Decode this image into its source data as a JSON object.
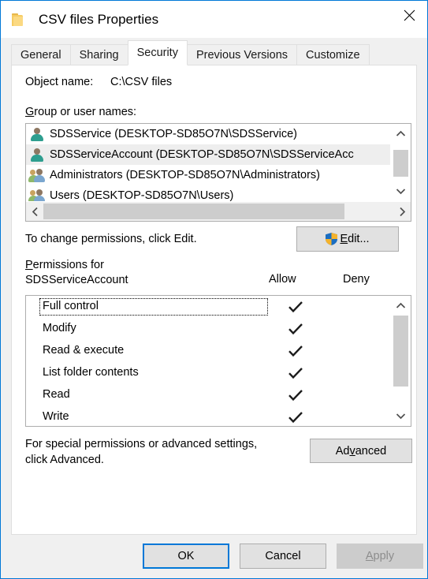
{
  "window": {
    "title": "CSV files Properties",
    "folder_icon": "folder-icon",
    "close_icon": "close-icon",
    "border_color": "#0078d7"
  },
  "tabs": [
    {
      "label": "General",
      "active": false
    },
    {
      "label": "Sharing",
      "active": false
    },
    {
      "label": "Security",
      "active": true
    },
    {
      "label": "Previous Versions",
      "active": false
    },
    {
      "label": "Customize",
      "active": false
    }
  ],
  "security": {
    "object_name_label": "Object name:",
    "object_name_value": "C:\\CSV files",
    "group_label_accel": "G",
    "group_label_rest": "roup or user names:",
    "users": [
      {
        "name": "SDSService (DESKTOP-SD85O7N\\SDSService)",
        "icon": "user-icon",
        "selected": false
      },
      {
        "name": "SDSServiceAccount (DESKTOP-SD85O7N\\SDSServiceAcc",
        "icon": "user-icon",
        "selected": true
      },
      {
        "name": "Administrators (DESKTOP-SD85O7N\\Administrators)",
        "icon": "group-icon",
        "selected": false
      },
      {
        "name": "Users (DESKTOP-SD85O7N\\Users)",
        "icon": "group-icon",
        "selected": false
      }
    ],
    "edit_hint": "To change permissions, click Edit.",
    "edit_button_accel_before": "",
    "edit_button_accel": "E",
    "edit_button_rest": "dit...",
    "edit_shield_icon": "uac-shield-icon",
    "permissions_label_accel": "P",
    "permissions_label_rest": "ermissions for",
    "permissions_subject": "SDSServiceAccount",
    "column_allow": "Allow",
    "column_deny": "Deny",
    "permissions": [
      {
        "name": "Full control",
        "allow": true,
        "deny": false,
        "focused": true
      },
      {
        "name": "Modify",
        "allow": true,
        "deny": false,
        "focused": false
      },
      {
        "name": "Read & execute",
        "allow": true,
        "deny": false,
        "focused": false
      },
      {
        "name": "List folder contents",
        "allow": true,
        "deny": false,
        "focused": false
      },
      {
        "name": "Read",
        "allow": true,
        "deny": false,
        "focused": false
      },
      {
        "name": "Write",
        "allow": true,
        "deny": false,
        "focused": false
      }
    ],
    "advanced_hint_line1": "For special permissions or advanced settings,",
    "advanced_hint_line2": "click Advanced.",
    "advanced_button_before": "Ad",
    "advanced_button_accel": "v",
    "advanced_button_rest": "anced"
  },
  "footer": {
    "ok_label": "OK",
    "cancel_label": "Cancel",
    "apply_accel": "A",
    "apply_rest": "pply",
    "apply_disabled": true
  }
}
